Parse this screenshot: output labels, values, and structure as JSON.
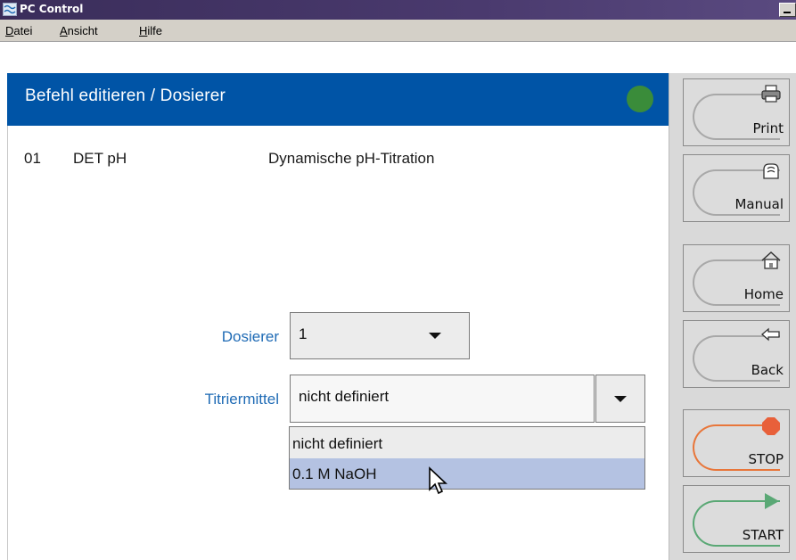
{
  "window": {
    "title": "PC Control"
  },
  "menu": {
    "items": [
      {
        "underline": "D",
        "rest": "atei"
      },
      {
        "underline": "A",
        "rest": "nsicht"
      },
      {
        "underline": "H",
        "rest": "ilfe"
      }
    ]
  },
  "header": {
    "title": "Befehl editieren / Dosierer",
    "status_color": "#3a8c3a"
  },
  "method": {
    "number": "01",
    "name": "DET pH",
    "description": "Dynamische pH-Titration"
  },
  "form": {
    "dosierer": {
      "label": "Dosierer",
      "value": "1"
    },
    "titriermittel": {
      "label": "Titriermittel",
      "value": "nicht definiert",
      "options": [
        "nicht definiert",
        "0.1 M NaOH"
      ],
      "highlighted_option": "0.1 M NaOH"
    }
  },
  "sidebar": {
    "print": "Print",
    "manual": "Manual",
    "home": "Home",
    "back": "Back",
    "stop": "STOP",
    "start": "START"
  },
  "icons": [
    "app-icon",
    "printer-icon",
    "manual-icon",
    "home-icon",
    "back-arrow-icon",
    "stop-icon",
    "start-icon",
    "mouse-cursor-icon"
  ],
  "colors": {
    "header": "#0054a6",
    "label": "#1f6bb5",
    "selected_option": "#b4c2e2",
    "stop": "#e8763a",
    "start": "#5aa875"
  }
}
